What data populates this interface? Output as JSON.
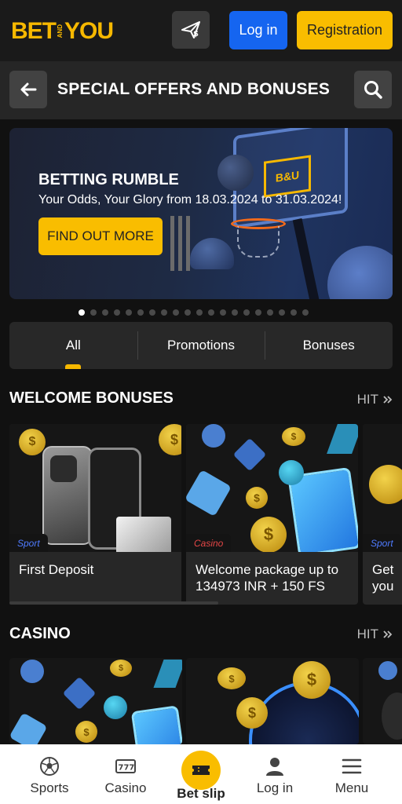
{
  "header": {
    "logo": {
      "left": "BET",
      "small_top": "AND",
      "right": "YOU"
    },
    "promo_icon": "paper-plane-dollar-icon",
    "login_label": "Log in",
    "register_label": "Registration"
  },
  "titlebar": {
    "title": "SPECIAL OFFERS AND BONUSES",
    "back_icon": "arrow-left-icon",
    "search_icon": "search-icon"
  },
  "banner": {
    "title": "BETTING RUMBLE",
    "subtitle": "Your Odds, Your Glory from 18.03.2024 to 31.03.2024!",
    "cta": "FIND OUT MORE",
    "board_text": "B&U",
    "slide_count": 20,
    "active_slide": 1
  },
  "tabs": [
    {
      "label": "All",
      "active": true
    },
    {
      "label": "Promotions",
      "active": false
    },
    {
      "label": "Bonuses",
      "active": false
    }
  ],
  "welcome": {
    "title": "WELCOME BONUSES",
    "hit_label": "HIT",
    "cards": [
      {
        "tag": "Sport",
        "title": "First Deposit"
      },
      {
        "tag": "Casino",
        "title": "Welcome package up to 134973 INR + 150 FS"
      },
      {
        "tag": "Sport",
        "title": "Get you"
      }
    ]
  },
  "casino": {
    "title": "CASINO",
    "hit_label": "HIT"
  },
  "bottom_nav": {
    "items": [
      {
        "label": "Sports",
        "icon": "soccer-ball-icon"
      },
      {
        "label": "Casino",
        "icon": "slot-777-icon"
      },
      {
        "label": "Bet slip",
        "icon": "ticket-icon"
      },
      {
        "label": "Log in",
        "icon": "user-icon"
      },
      {
        "label": "Menu",
        "icon": "hamburger-menu-icon"
      }
    ]
  },
  "colors": {
    "accent": "#f9bd00",
    "primary_blue": "#1565f0",
    "background": "#111111",
    "sport_tag": "#4f7bff",
    "casino_tag": "#e34646"
  }
}
